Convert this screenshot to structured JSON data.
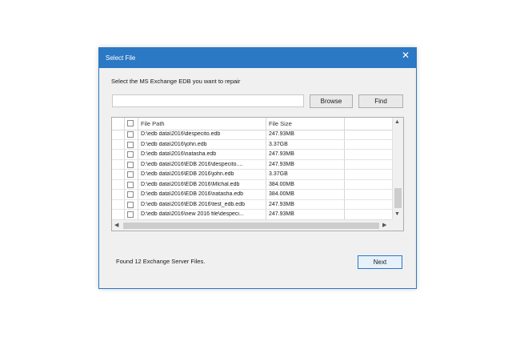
{
  "dialog": {
    "title": "Select File",
    "close_glyph": "✕",
    "prompt": "Select the MS Exchange EDB you want to repair",
    "path_value": "",
    "browse_label": "Browse",
    "find_label": "Find",
    "status_text": "Found 12 Exchange Server Files.",
    "next_label": "Next"
  },
  "table": {
    "columns": [
      "File Path",
      "File Size"
    ],
    "rows": [
      {
        "path": "D:\\edb data\\2016\\despecito.edb",
        "size": "247.93MB"
      },
      {
        "path": "D:\\edb data\\2016\\john.edb",
        "size": "3.37GB"
      },
      {
        "path": "D:\\edb data\\2016\\natasha.edb",
        "size": "247.93MB"
      },
      {
        "path": "D:\\edb data\\2016\\EDB 2016\\despecito....",
        "size": "247.93MB"
      },
      {
        "path": "D:\\edb data\\2016\\EDB 2016\\john.edb",
        "size": "3.37GB"
      },
      {
        "path": "D:\\edb data\\2016\\EDB 2016\\Mlchal.edb",
        "size": "384.00MB"
      },
      {
        "path": "D:\\edb data\\2016\\EDB 2016\\natasha.edb",
        "size": "384.00MB"
      },
      {
        "path": "D:\\edb data\\2016\\EDB 2016\\test_edb.edb",
        "size": "247.93MB"
      },
      {
        "path": "D:\\edb data\\2016\\new 2016 file\\despeci...",
        "size": "247.93MB"
      }
    ]
  },
  "icons": {
    "scroll_up": "▲",
    "scroll_down": "▼",
    "scroll_left": "◀",
    "scroll_right": "▶"
  },
  "colors": {
    "titlebar": "#2b78c4",
    "dialog_bg": "#f0f0f0"
  }
}
